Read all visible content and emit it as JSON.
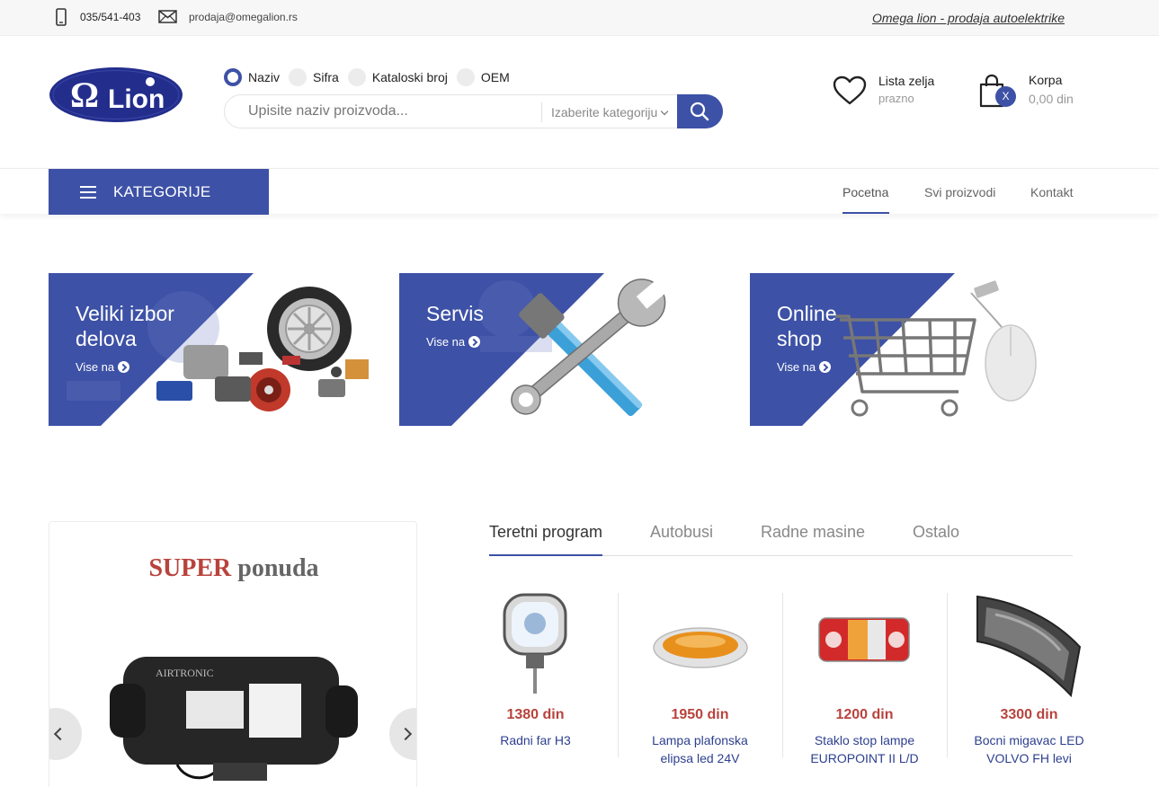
{
  "topbar": {
    "phone": "035/541-403",
    "email": "prodaja@omegalion.rs",
    "tagline": "Omega lion - prodaja autoelektrike"
  },
  "brand": {
    "logo_text": "ΩLion"
  },
  "search": {
    "options": [
      "Naziv",
      "Sifra",
      "Kataloski broj",
      "OEM"
    ],
    "selected_option": "Naziv",
    "placeholder": "Upisite naziv proizvoda...",
    "category_label": "Izaberite kategoriju"
  },
  "wishlist": {
    "title": "Lista zelja",
    "status": "prazno"
  },
  "cart": {
    "title": "Korpa",
    "total": "0,00 din",
    "badge": "X"
  },
  "nav": {
    "categories_label": "KATEGORIJE",
    "links": [
      "Pocetna",
      "Svi proizvodi",
      "Kontakt"
    ],
    "active": "Pocetna"
  },
  "banners": [
    {
      "title_line1": "Veliki izbor",
      "title_line2": "delova",
      "link": "Vise na"
    },
    {
      "title_line1": "Servis",
      "title_line2": "",
      "link": "Vise na"
    },
    {
      "title_line1": "Online",
      "title_line2": "shop",
      "link": "Vise na"
    }
  ],
  "promo": {
    "title_red": "SUPER",
    "title_gray": "ponuda",
    "product_brand": "AIRTRONIC"
  },
  "tabs": [
    "Teretni program",
    "Autobusi",
    "Radne masine",
    "Ostalo"
  ],
  "active_tab": "Teretni program",
  "products": [
    {
      "price": "1380 din",
      "name_line1": "Radni far H3",
      "name_line2": ""
    },
    {
      "price": "1950 din",
      "name_line1": "Lampa plafonska",
      "name_line2": "elipsa led 24V"
    },
    {
      "price": "1200 din",
      "name_line1": "Staklo stop lampe",
      "name_line2": "EUROPOINT II L/D"
    },
    {
      "price": "3300 din",
      "name_line1": "Bocni migavac LED",
      "name_line2": "VOLVO FH levi"
    }
  ],
  "colors": {
    "accent": "#3d51a6",
    "price": "#b8433c",
    "link": "#2d3f8f"
  }
}
